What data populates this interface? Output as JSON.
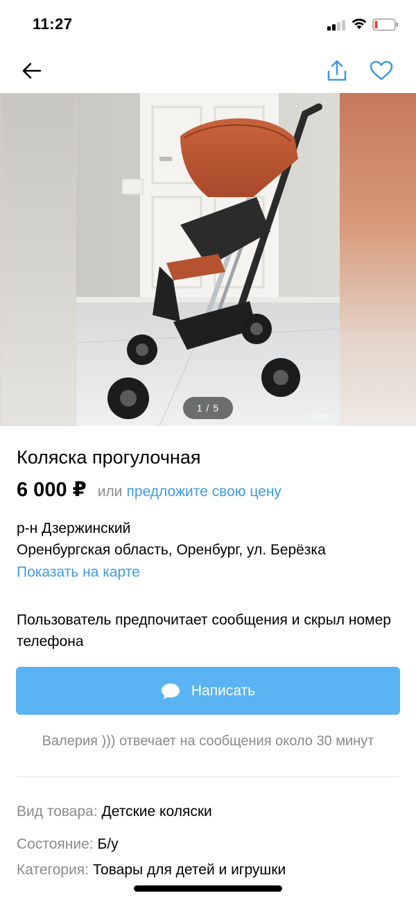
{
  "status_bar": {
    "time": "11:27"
  },
  "nav": {
    "back_icon": "arrow-left-icon",
    "share_icon": "share-icon",
    "favorite_icon": "heart-outline-icon"
  },
  "gallery": {
    "page_indicator": "1 / 5",
    "watermark": "Avito"
  },
  "listing": {
    "title": "Коляска прогулочная",
    "price": "6 000 ₽",
    "price_or": "или",
    "price_offer": "предложите свою цену",
    "district": "р-н Дзержинский",
    "address": "Оренбургская область, Оренбург, ул. Берёзка",
    "map_link": "Показать на карте",
    "contact_note": "Пользователь предпочитает сообщения и скрыл номер телефона",
    "write_button": "Написать",
    "reply_time": "Валерия ))) отвечает на сообщения около 30 минут"
  },
  "params": [
    {
      "label": "Вид товара:",
      "value": "Детские коляски"
    },
    {
      "label": "Состояние:",
      "value": "Б/у"
    },
    {
      "label": "Категория:",
      "value": "Товары для детей и игрушки"
    }
  ],
  "colors": {
    "accent": "#3d9ae8",
    "button": "#5ab3f3",
    "muted": "#8a8a8a"
  }
}
